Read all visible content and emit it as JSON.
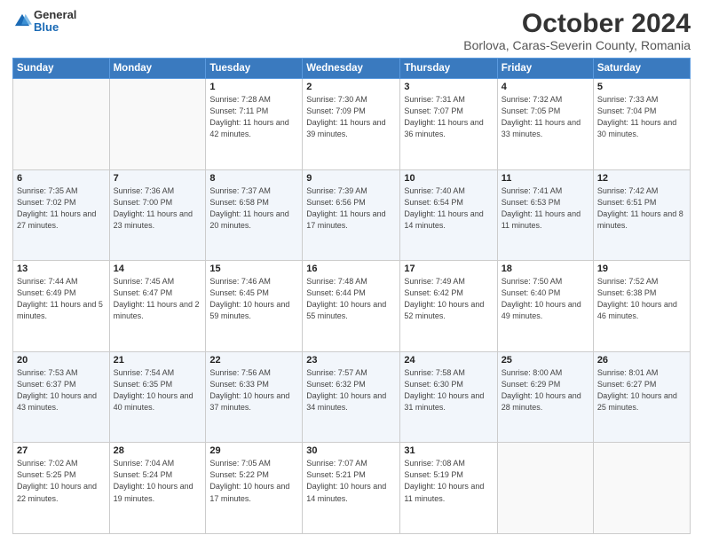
{
  "header": {
    "logo": {
      "general": "General",
      "blue": "Blue"
    },
    "title": "October 2024",
    "subtitle": "Borlova, Caras-Severin County, Romania"
  },
  "calendar": {
    "days_of_week": [
      "Sunday",
      "Monday",
      "Tuesday",
      "Wednesday",
      "Thursday",
      "Friday",
      "Saturday"
    ],
    "weeks": [
      [
        {
          "day": "",
          "info": ""
        },
        {
          "day": "",
          "info": ""
        },
        {
          "day": "1",
          "info": "Sunrise: 7:28 AM\nSunset: 7:11 PM\nDaylight: 11 hours and 42 minutes."
        },
        {
          "day": "2",
          "info": "Sunrise: 7:30 AM\nSunset: 7:09 PM\nDaylight: 11 hours and 39 minutes."
        },
        {
          "day": "3",
          "info": "Sunrise: 7:31 AM\nSunset: 7:07 PM\nDaylight: 11 hours and 36 minutes."
        },
        {
          "day": "4",
          "info": "Sunrise: 7:32 AM\nSunset: 7:05 PM\nDaylight: 11 hours and 33 minutes."
        },
        {
          "day": "5",
          "info": "Sunrise: 7:33 AM\nSunset: 7:04 PM\nDaylight: 11 hours and 30 minutes."
        }
      ],
      [
        {
          "day": "6",
          "info": "Sunrise: 7:35 AM\nSunset: 7:02 PM\nDaylight: 11 hours and 27 minutes."
        },
        {
          "day": "7",
          "info": "Sunrise: 7:36 AM\nSunset: 7:00 PM\nDaylight: 11 hours and 23 minutes."
        },
        {
          "day": "8",
          "info": "Sunrise: 7:37 AM\nSunset: 6:58 PM\nDaylight: 11 hours and 20 minutes."
        },
        {
          "day": "9",
          "info": "Sunrise: 7:39 AM\nSunset: 6:56 PM\nDaylight: 11 hours and 17 minutes."
        },
        {
          "day": "10",
          "info": "Sunrise: 7:40 AM\nSunset: 6:54 PM\nDaylight: 11 hours and 14 minutes."
        },
        {
          "day": "11",
          "info": "Sunrise: 7:41 AM\nSunset: 6:53 PM\nDaylight: 11 hours and 11 minutes."
        },
        {
          "day": "12",
          "info": "Sunrise: 7:42 AM\nSunset: 6:51 PM\nDaylight: 11 hours and 8 minutes."
        }
      ],
      [
        {
          "day": "13",
          "info": "Sunrise: 7:44 AM\nSunset: 6:49 PM\nDaylight: 11 hours and 5 minutes."
        },
        {
          "day": "14",
          "info": "Sunrise: 7:45 AM\nSunset: 6:47 PM\nDaylight: 11 hours and 2 minutes."
        },
        {
          "day": "15",
          "info": "Sunrise: 7:46 AM\nSunset: 6:45 PM\nDaylight: 10 hours and 59 minutes."
        },
        {
          "day": "16",
          "info": "Sunrise: 7:48 AM\nSunset: 6:44 PM\nDaylight: 10 hours and 55 minutes."
        },
        {
          "day": "17",
          "info": "Sunrise: 7:49 AM\nSunset: 6:42 PM\nDaylight: 10 hours and 52 minutes."
        },
        {
          "day": "18",
          "info": "Sunrise: 7:50 AM\nSunset: 6:40 PM\nDaylight: 10 hours and 49 minutes."
        },
        {
          "day": "19",
          "info": "Sunrise: 7:52 AM\nSunset: 6:38 PM\nDaylight: 10 hours and 46 minutes."
        }
      ],
      [
        {
          "day": "20",
          "info": "Sunrise: 7:53 AM\nSunset: 6:37 PM\nDaylight: 10 hours and 43 minutes."
        },
        {
          "day": "21",
          "info": "Sunrise: 7:54 AM\nSunset: 6:35 PM\nDaylight: 10 hours and 40 minutes."
        },
        {
          "day": "22",
          "info": "Sunrise: 7:56 AM\nSunset: 6:33 PM\nDaylight: 10 hours and 37 minutes."
        },
        {
          "day": "23",
          "info": "Sunrise: 7:57 AM\nSunset: 6:32 PM\nDaylight: 10 hours and 34 minutes."
        },
        {
          "day": "24",
          "info": "Sunrise: 7:58 AM\nSunset: 6:30 PM\nDaylight: 10 hours and 31 minutes."
        },
        {
          "day": "25",
          "info": "Sunrise: 8:00 AM\nSunset: 6:29 PM\nDaylight: 10 hours and 28 minutes."
        },
        {
          "day": "26",
          "info": "Sunrise: 8:01 AM\nSunset: 6:27 PM\nDaylight: 10 hours and 25 minutes."
        }
      ],
      [
        {
          "day": "27",
          "info": "Sunrise: 7:02 AM\nSunset: 5:25 PM\nDaylight: 10 hours and 22 minutes."
        },
        {
          "day": "28",
          "info": "Sunrise: 7:04 AM\nSunset: 5:24 PM\nDaylight: 10 hours and 19 minutes."
        },
        {
          "day": "29",
          "info": "Sunrise: 7:05 AM\nSunset: 5:22 PM\nDaylight: 10 hours and 17 minutes."
        },
        {
          "day": "30",
          "info": "Sunrise: 7:07 AM\nSunset: 5:21 PM\nDaylight: 10 hours and 14 minutes."
        },
        {
          "day": "31",
          "info": "Sunrise: 7:08 AM\nSunset: 5:19 PM\nDaylight: 10 hours and 11 minutes."
        },
        {
          "day": "",
          "info": ""
        },
        {
          "day": "",
          "info": ""
        }
      ]
    ]
  }
}
